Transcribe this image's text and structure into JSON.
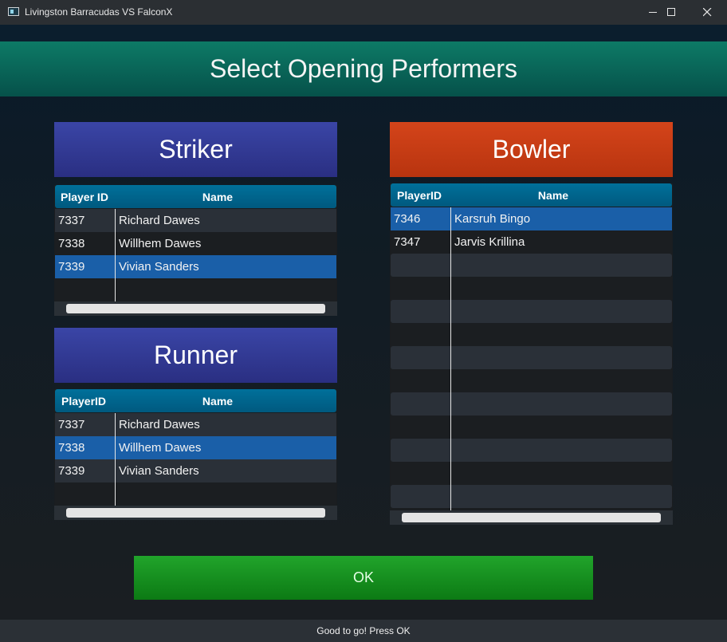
{
  "window": {
    "title": "Livingston Barracudas VS FalconX",
    "icon": "app-window-icon",
    "controls": [
      "minimize-icon",
      "maximize-icon",
      "close-icon"
    ]
  },
  "header": {
    "title": "Select Opening Performers"
  },
  "striker": {
    "title": "Striker",
    "columns": {
      "id": "Player ID",
      "name": "Name"
    },
    "rows": [
      {
        "id": "7337",
        "name": "Richard Dawes"
      },
      {
        "id": "7338",
        "name": "Willhem Dawes"
      },
      {
        "id": "7339",
        "name": "Vivian Sanders",
        "selected": true
      }
    ]
  },
  "runner": {
    "title": "Runner",
    "columns": {
      "id": "PlayerID",
      "name": "Name"
    },
    "rows": [
      {
        "id": "7337",
        "name": "Richard Dawes"
      },
      {
        "id": "7338",
        "name": "Willhem Dawes",
        "selected": true
      },
      {
        "id": "7339",
        "name": "Vivian Sanders"
      }
    ]
  },
  "bowler": {
    "title": "Bowler",
    "columns": {
      "id": "PlayerID",
      "name": "Name"
    },
    "rows": [
      {
        "id": "7346",
        "name": "Karsruh Bingo",
        "selected": true
      },
      {
        "id": "7347",
        "name": "Jarvis Krillina"
      }
    ]
  },
  "ok_label": "OK",
  "status": "Good to go! Press OK",
  "colors": {
    "header": "#0d7a66",
    "striker_runner_panel": "#3a45a6",
    "bowler_panel": "#d4441a",
    "table_header": "#00709a",
    "selection": "#1a5fa8",
    "ok_button": "#21a42b"
  }
}
